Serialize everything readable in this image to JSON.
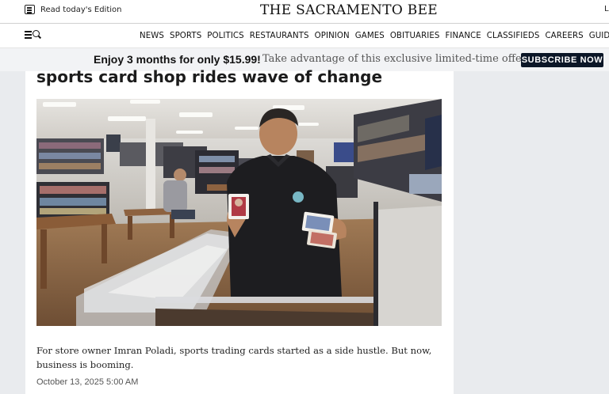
{
  "topbar": {
    "edition_label": "Read today's Edition",
    "masthead": "THE SACRAMENTO BEE",
    "login_label": "L"
  },
  "nav": {
    "items": [
      "NEWS",
      "SPORTS",
      "POLITICS",
      "RESTAURANTS",
      "OPINION",
      "GAMES",
      "OBITUARIES",
      "FINANCE",
      "CLASSIFIEDS",
      "CAREERS",
      "GUIDES"
    ]
  },
  "promo": {
    "headline": "Enjoy 3 months for only $15.99!",
    "text": "Take advantage of this exclusive limited-time offer.",
    "button_label": "SUBSCRIBE NOW"
  },
  "article": {
    "headline": "sports card shop rides wave of change",
    "caption": "For store owner Imran Poladi, sports trading cards started as a side hustle. But now, business is booming.",
    "date": "October 13, 2025 5:00 AM"
  },
  "colors": {
    "subscribe_bg": "#0b1627",
    "page_bg": "#e9ebee"
  }
}
